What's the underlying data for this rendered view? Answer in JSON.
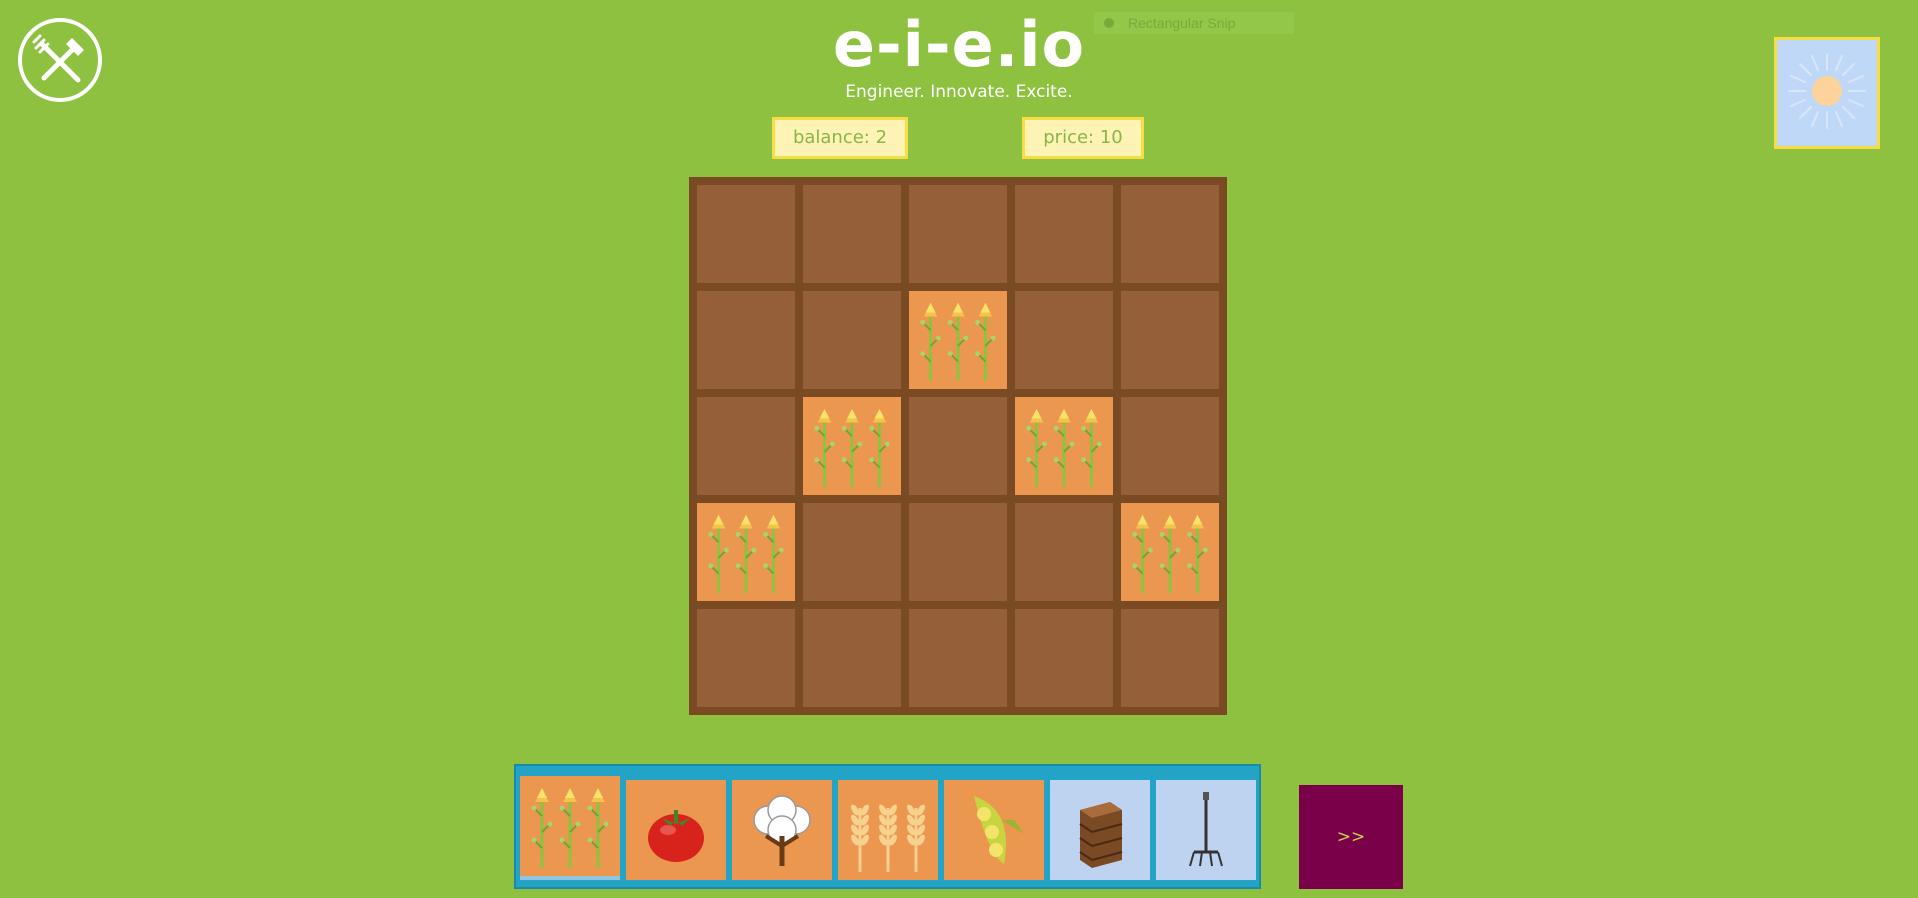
{
  "header": {
    "title": "e-i-e.io",
    "tagline": "Engineer. Innovate. Excite.",
    "logo_icon": "fork-and-shovel-icon"
  },
  "overlay": {
    "snip_label": "Rectangular Snip"
  },
  "stats": {
    "balance_label": "balance: 2",
    "price_label": "price: 10"
  },
  "weather": {
    "icon": "sun-icon",
    "condition": "sunny"
  },
  "field": {
    "rows": 5,
    "cols": 5,
    "grid": [
      [
        "empty",
        "empty",
        "empty",
        "empty",
        "empty"
      ],
      [
        "empty",
        "empty",
        "asparagus",
        "empty",
        "empty"
      ],
      [
        "empty",
        "asparagus",
        "empty",
        "asparagus",
        "empty"
      ],
      [
        "asparagus",
        "empty",
        "empty",
        "empty",
        "asparagus"
      ],
      [
        "empty",
        "empty",
        "empty",
        "empty",
        "empty"
      ]
    ]
  },
  "toolbar": {
    "selected": "asparagus",
    "items": [
      {
        "id": "asparagus",
        "icon": "asparagus-icon",
        "kind": "crop"
      },
      {
        "id": "tomato",
        "icon": "tomato-icon",
        "kind": "crop"
      },
      {
        "id": "cotton",
        "icon": "cotton-icon",
        "kind": "crop"
      },
      {
        "id": "wheat",
        "icon": "wheat-icon",
        "kind": "crop"
      },
      {
        "id": "soybean",
        "icon": "soybean-icon",
        "kind": "crop"
      },
      {
        "id": "crate",
        "icon": "crate-icon",
        "kind": "tool"
      },
      {
        "id": "pitchfork",
        "icon": "pitchfork-icon",
        "kind": "tool"
      }
    ]
  },
  "next_button": {
    "label": ">>"
  },
  "colors": {
    "background": "#8dc13f",
    "soil": "#955f39",
    "planted_soil": "#eb9750",
    "field_border": "#7a4b23",
    "toolbar": "#23a3c6",
    "stat_bg": "#fdf3b4",
    "stat_border": "#f7dc43",
    "next_button": "#7a004a"
  }
}
